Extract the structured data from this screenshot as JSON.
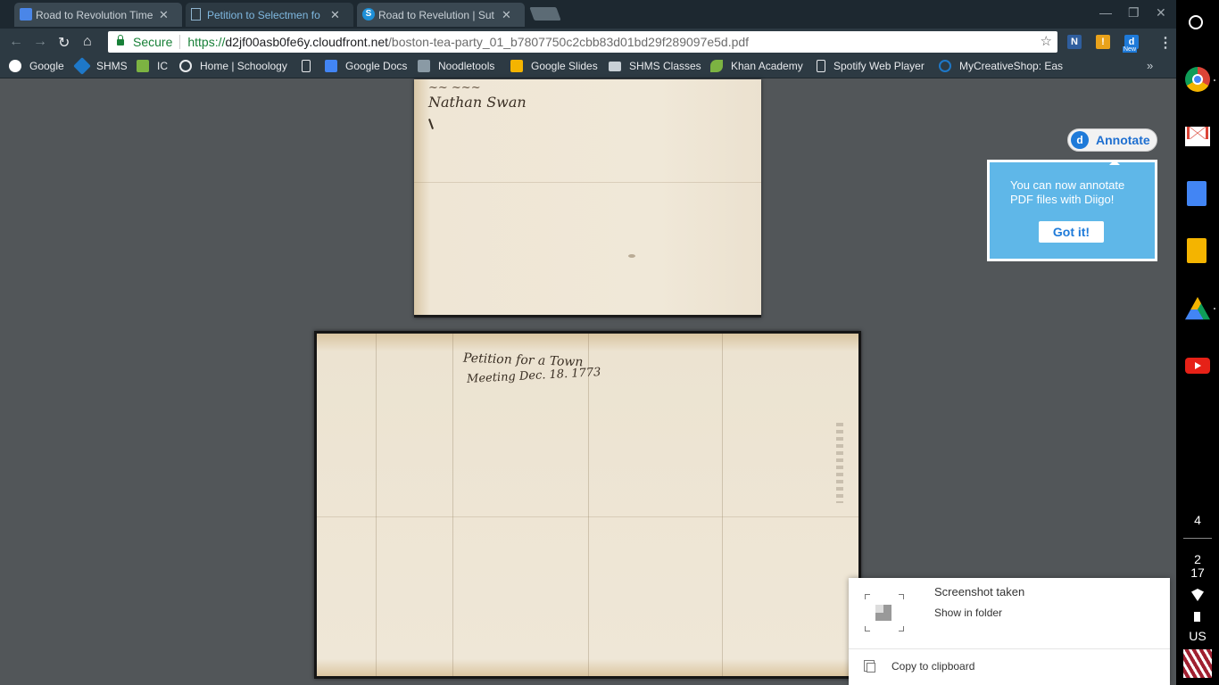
{
  "tabs": [
    {
      "title": "Road to Revolution Time",
      "icon": "docs-icon"
    },
    {
      "title": "Petition to Selectmen fo",
      "icon": "page-icon"
    },
    {
      "title": "Road to Revelution | Sut",
      "icon": "s-icon"
    }
  ],
  "omnibox": {
    "secure_label": "Secure",
    "url_scheme": "https://",
    "url_host": "d2jf00asb0fe6y.cloudfront.net",
    "url_path": "/boston-tea-party_01_b7807750c2cbb83d01bd29f289097e5d.pdf"
  },
  "extensions": [
    {
      "label": "N",
      "color": "#2f5e9e"
    },
    {
      "label": "!",
      "color": "#e9a21b"
    },
    {
      "label": "d",
      "color": "#1e7ad9",
      "badge": "New"
    }
  ],
  "bookmarks": [
    {
      "label": "Google",
      "color": "#4285f4"
    },
    {
      "label": "SHMS",
      "color": "#1e78c8"
    },
    {
      "label": "IC",
      "color": "#7cb342"
    },
    {
      "label": "Home | Schoology",
      "color": "#e8eaed"
    },
    {
      "label": "",
      "color": "#e8eaed"
    },
    {
      "label": "Google Docs",
      "color": "#4285f4"
    },
    {
      "label": "Noodletools",
      "color": "#9aa"
    },
    {
      "label": "Google Slides",
      "color": "#f4b400"
    },
    {
      "label": "SHMS Classes",
      "color": "#c8d0d6"
    },
    {
      "label": "Khan Academy",
      "color": "#7cb342"
    },
    {
      "label": "Spotify Web Player",
      "color": "#e8eaed"
    },
    {
      "label": "MyCreativeShop: Eas",
      "color": "#1e78c8"
    }
  ],
  "pdf": {
    "page1_signature": "Nathan Swan",
    "page2_docket_line1": "Petition for a Town",
    "page2_docket_line2": "Meeting Dec. 18. 1773"
  },
  "diigo": {
    "annotate_label": "Annotate",
    "message": "You can now annotate PDF files with Diigo!",
    "button": "Got it!"
  },
  "notification": {
    "title": "Screenshot taken",
    "action": "Show in folder",
    "copy": "Copy to clipboard"
  },
  "shelf": {
    "apps": [
      "chrome-icon",
      "gmail-icon",
      "docs-icon",
      "slides-icon",
      "drive-icon",
      "youtube-icon"
    ],
    "notification_count": "4",
    "time_hour": "2",
    "time_minute": "17",
    "keyboard": "US"
  }
}
